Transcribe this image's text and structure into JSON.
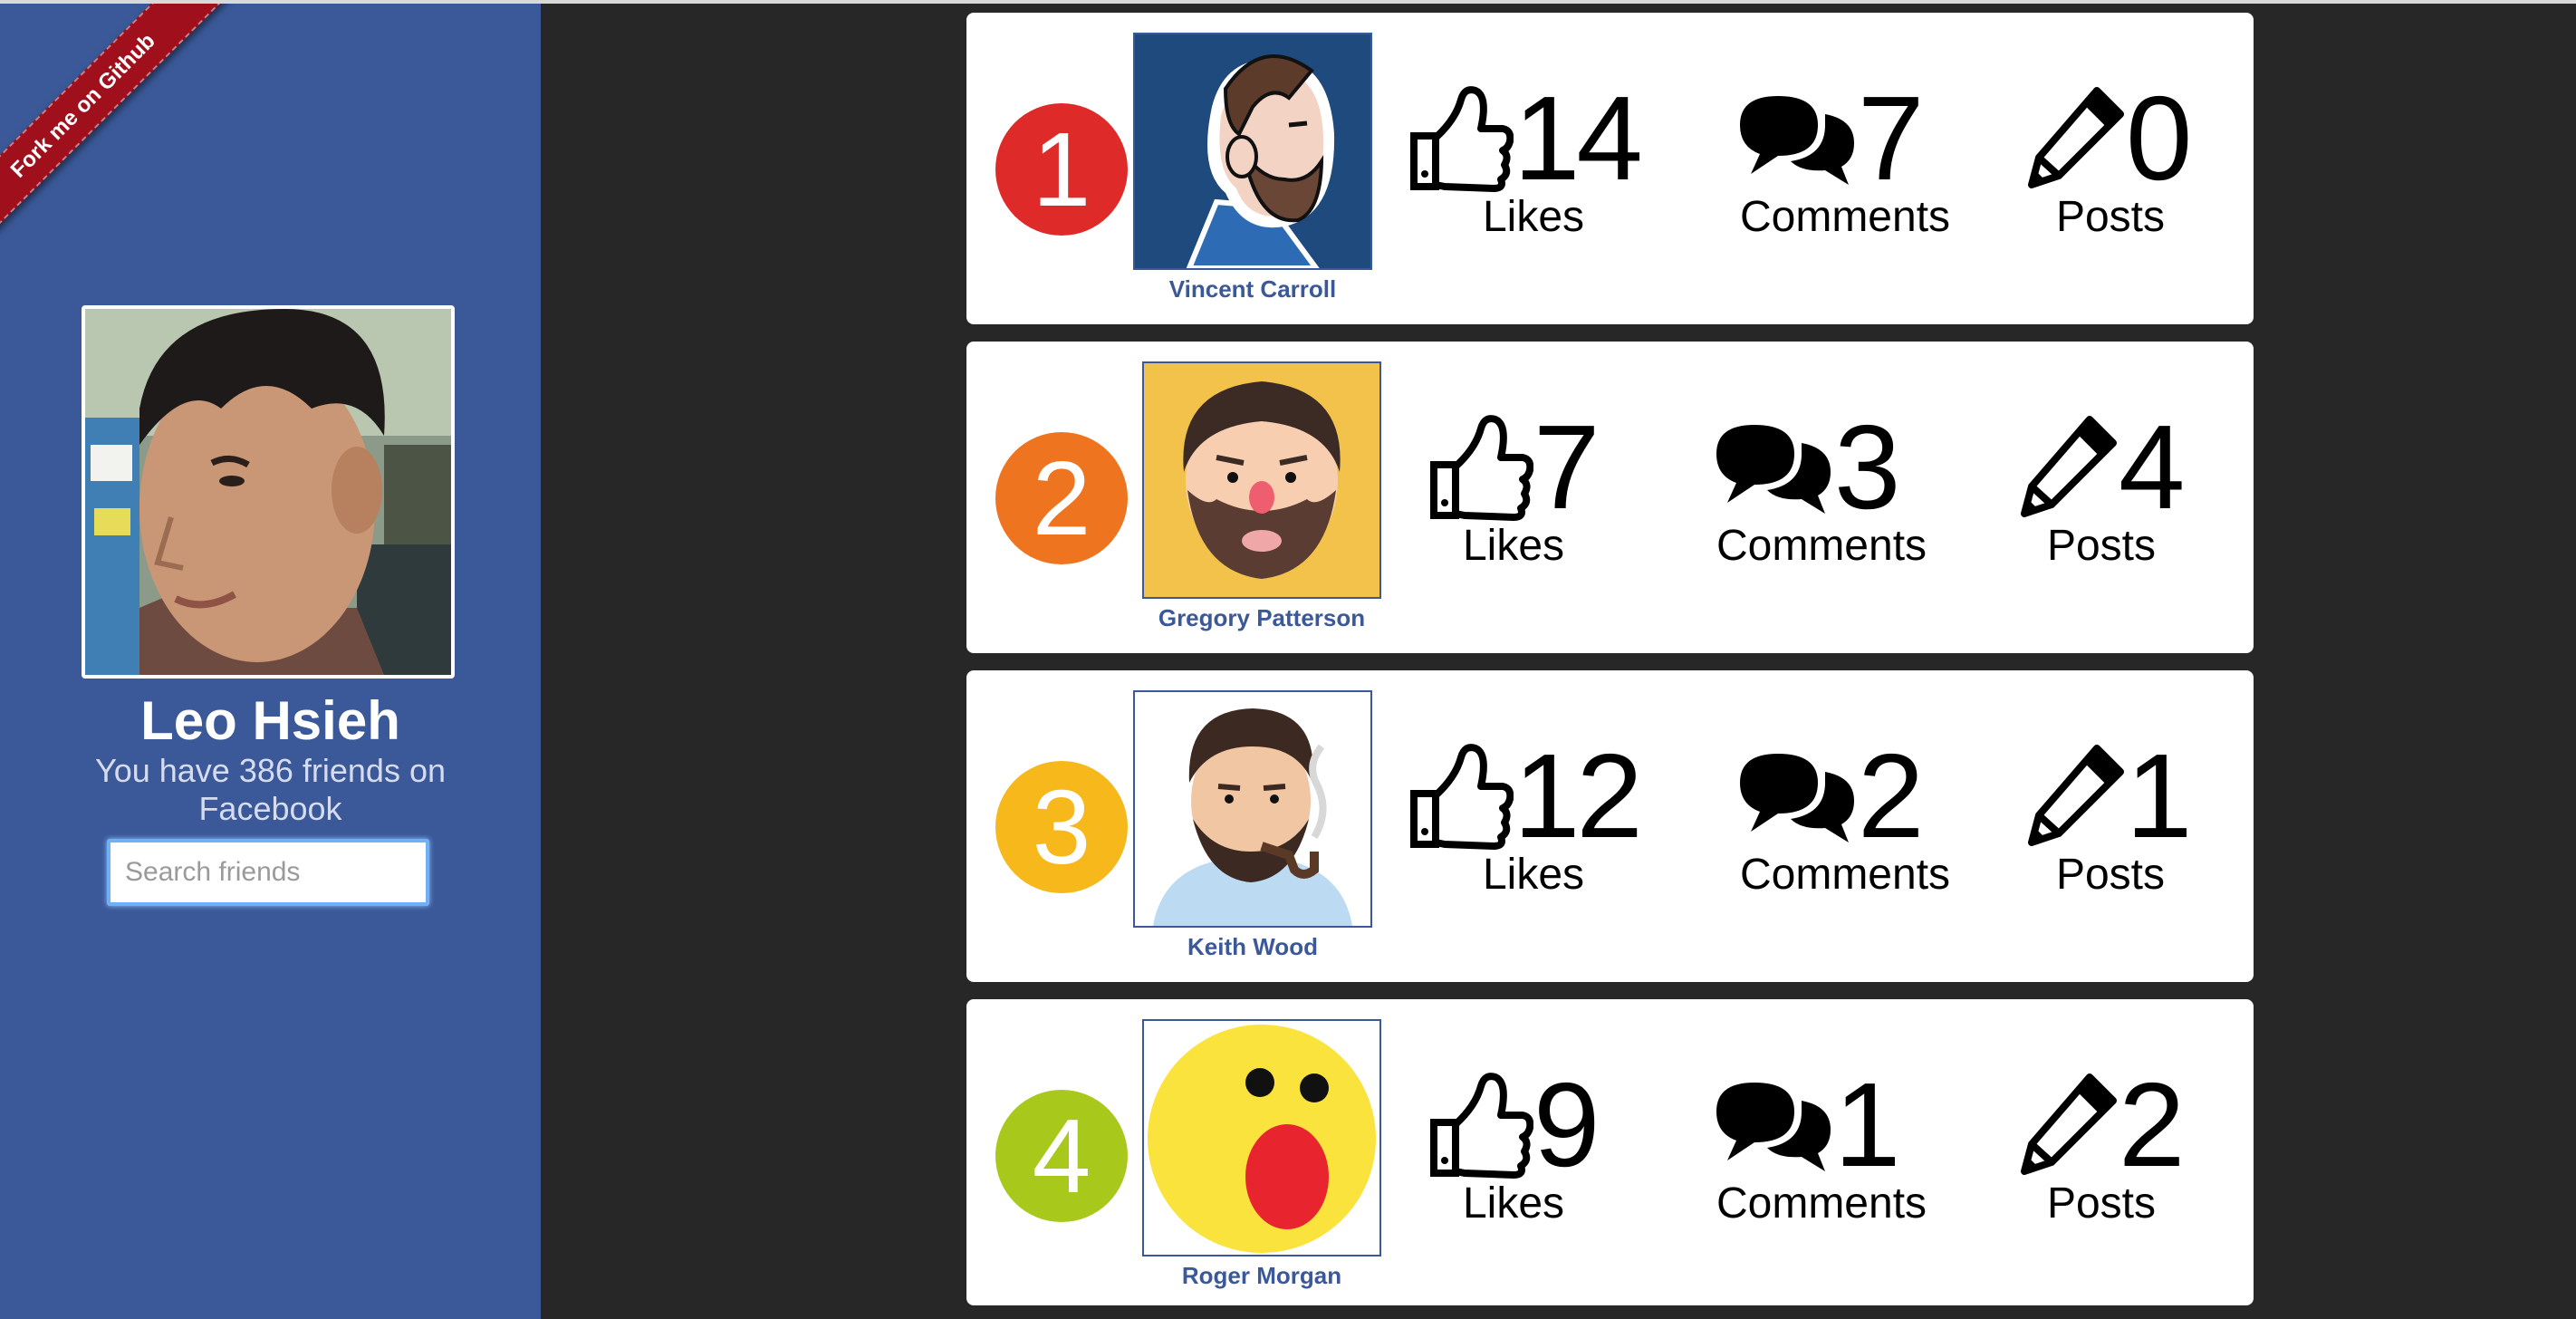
{
  "ribbon": {
    "label": "Fork me on Github"
  },
  "profile": {
    "name": "Leo Hsieh",
    "subtitle": "You have 386 friends on Facebook"
  },
  "search": {
    "placeholder": "Search friends",
    "value": ""
  },
  "stat_labels": {
    "likes": "Likes",
    "comments": "Comments",
    "posts": "Posts"
  },
  "friends": [
    {
      "rank": "1",
      "name": "Vincent Carroll",
      "likes": "14",
      "comments": "7",
      "posts": "0",
      "rank_color": "#df2a2a"
    },
    {
      "rank": "2",
      "name": "Gregory Patterson",
      "likes": "7",
      "comments": "3",
      "posts": "4",
      "rank_color": "#ee7420"
    },
    {
      "rank": "3",
      "name": "Keith Wood",
      "likes": "12",
      "comments": "2",
      "posts": "1",
      "rank_color": "#f6b81b"
    },
    {
      "rank": "4",
      "name": "Roger Morgan",
      "likes": "9",
      "comments": "1",
      "posts": "2",
      "rank_color": "#a8c91c"
    }
  ]
}
